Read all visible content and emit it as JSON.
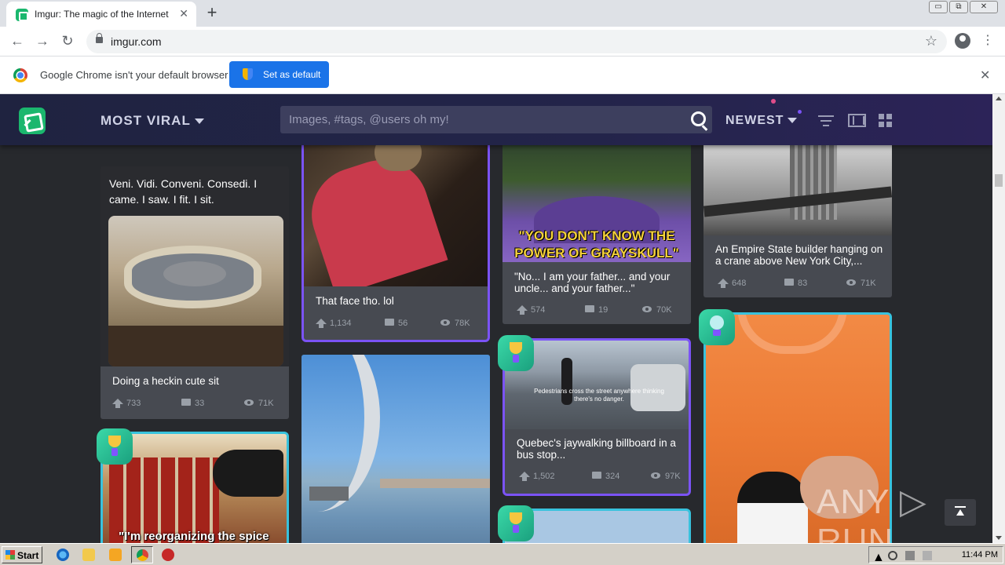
{
  "browser": {
    "tab_title": "Imgur: The magic of the Internet",
    "tab_close": "✕",
    "new_tab": "+",
    "url": "imgur.com",
    "window_controls": [
      "▭",
      "⧉",
      "✕"
    ],
    "infobar_message": "Google Chrome isn't your default browser",
    "set_default_label": "Set as default",
    "infobar_close": "✕"
  },
  "imgur": {
    "section_label": "MOST VIRAL",
    "search_placeholder": "Images, #tags, @users oh my!",
    "sort_label": "NEWEST",
    "cards": [
      {
        "title": "Veni. Vidi. Conveni. Consedi. I came. I saw. I fit. I sit.",
        "caption": "Doing a heckin cute sit",
        "upvotes": "733",
        "comments": "33",
        "views": "71K"
      },
      {
        "caption": "That face tho. lol",
        "upvotes": "1,134",
        "comments": "56",
        "views": "78K"
      },
      {
        "image_text": "\"YOU DON'T KNOW THE POWER OF GRAYSKULL\"",
        "caption": "\"No... I am your father... and your uncle... and your father...\"",
        "upvotes": "574",
        "comments": "19",
        "views": "70K"
      },
      {
        "caption": "An Empire State builder hanging on a crane above New York City,...",
        "upvotes": "648",
        "comments": "83",
        "views": "71K"
      },
      {
        "image_text": "Pedestrians cross the street anywhere thinking there's no danger.",
        "caption": "Quebec's jaywalking billboard in a bus stop...",
        "upvotes": "1,502",
        "comments": "324",
        "views": "97K"
      },
      {
        "image_text": "\"I'm reorganizing the spice"
      }
    ]
  },
  "watermark": "ANY ▷ RUN",
  "taskbar": {
    "start_label": "Start",
    "clock": "11:44 PM"
  },
  "colors": {
    "imgur_bg": "#27292d",
    "header_bg": "#1f2340",
    "card_bg": "#474a51",
    "highlight_blue": "#38c2dd",
    "highlight_purple": "#7b53f6",
    "chrome_blue": "#1a73e8",
    "imgur_green": "#1bb76e"
  }
}
